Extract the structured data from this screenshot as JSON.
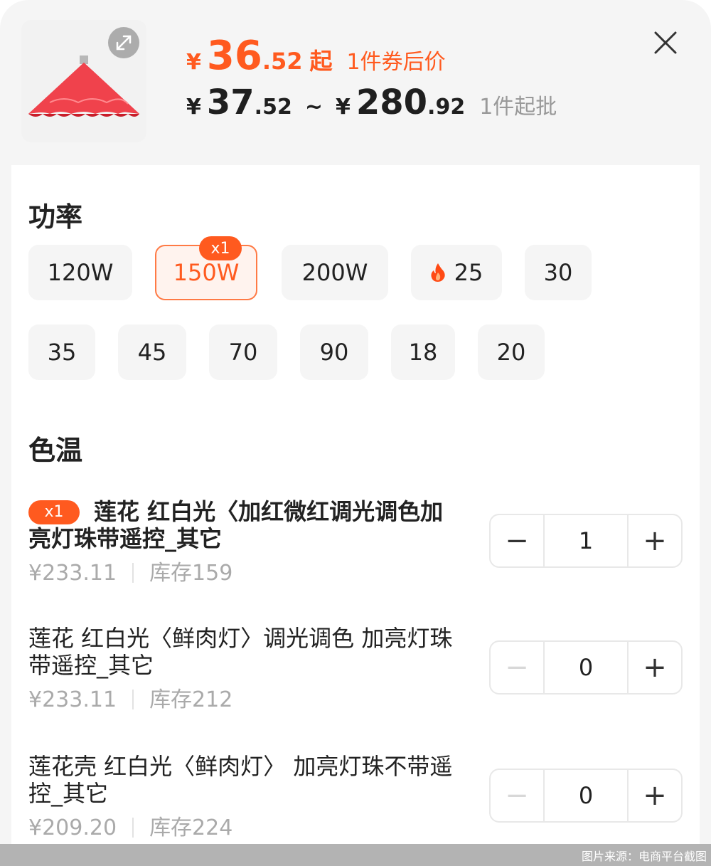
{
  "header": {
    "coupon_price": {
      "currency": "¥",
      "integer": "36",
      "decimal": ".52",
      "suffix": "起",
      "label": "1件券后价"
    },
    "price_range": {
      "currency_low": "¥",
      "low_integer": "37",
      "low_decimal": ".52",
      "separator": "~",
      "currency_high": "¥",
      "high_integer": "280",
      "high_decimal": ".92",
      "min_qty": "1件起批"
    }
  },
  "power": {
    "title": "功率",
    "options": [
      {
        "label": "120W"
      },
      {
        "label": "150W",
        "badge": "x1"
      },
      {
        "label": "200W"
      },
      {
        "label": "25",
        "icon": "fire-icon"
      },
      {
        "label": "30"
      },
      {
        "label": "35"
      },
      {
        "label": "45"
      },
      {
        "label": "70"
      },
      {
        "label": "90"
      },
      {
        "label": "18"
      },
      {
        "label": "20"
      }
    ],
    "selected": "150W"
  },
  "color_temp": {
    "title": "色温",
    "items": [
      {
        "badge": "x1",
        "name": "莲花 红白光〈加红微红调光调色加亮灯珠带遥控_其它",
        "price": "¥233.11",
        "stock": "库存159",
        "qty": "1"
      },
      {
        "name": "莲花  红白光〈鲜肉灯〉调光调色 加亮灯珠带遥控_其它",
        "price": "¥233.11",
        "stock": "库存212",
        "qty": "0"
      },
      {
        "name": "莲花壳  红白光〈鲜肉灯〉 加亮灯珠不带遥控_其它",
        "price": "¥209.20",
        "stock": "库存224",
        "qty": "0"
      }
    ],
    "minus": "−",
    "plus": "+"
  },
  "watermark": "图片来源：电商平台截图",
  "colors": {
    "accent": "#ff5a1f",
    "chip_bg": "#f5f5f5",
    "selected_bg": "#fff3ee"
  }
}
